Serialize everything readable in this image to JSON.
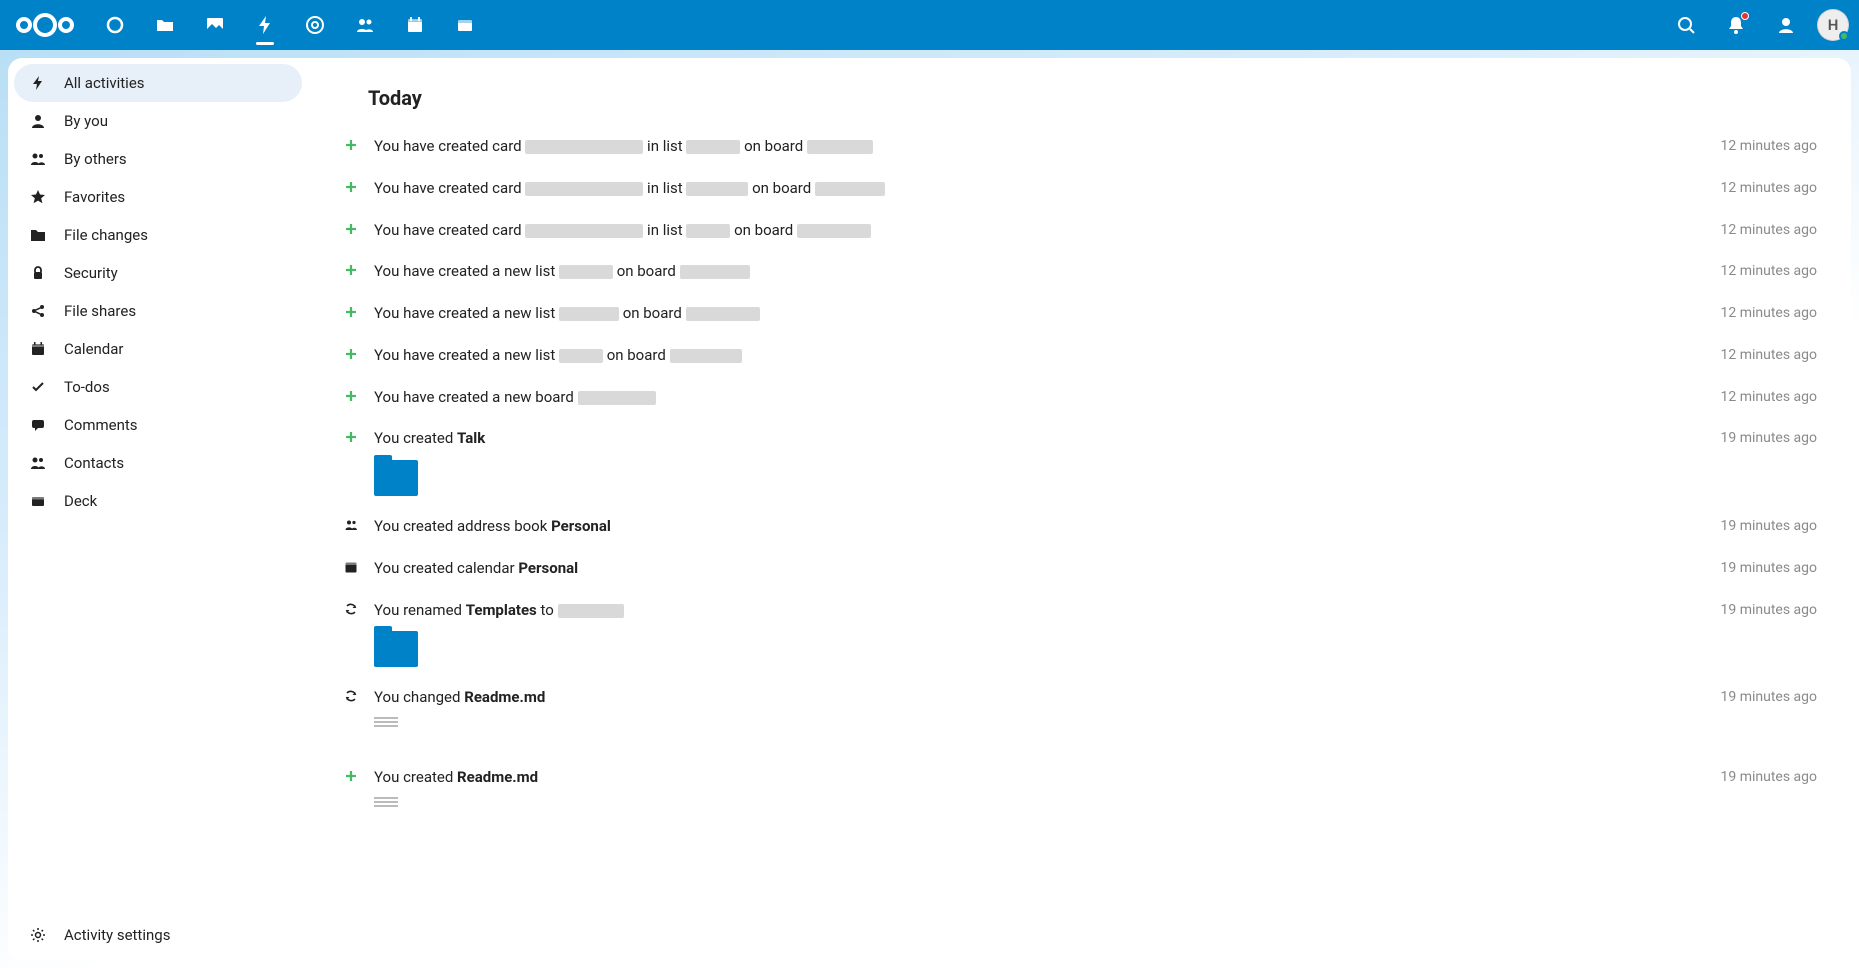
{
  "colors": {
    "brand": "#0082c9",
    "success": "#46ba61",
    "redact": "#d9d9d9"
  },
  "header": {
    "avatar_initial": "H"
  },
  "sidebar": {
    "items": [
      {
        "id": "all",
        "label": "All activities",
        "active": true
      },
      {
        "id": "by-you",
        "label": "By you"
      },
      {
        "id": "by-others",
        "label": "By others"
      },
      {
        "id": "favorites",
        "label": "Favorites"
      },
      {
        "id": "file-changes",
        "label": "File changes"
      },
      {
        "id": "security",
        "label": "Security"
      },
      {
        "id": "file-shares",
        "label": "File shares"
      },
      {
        "id": "calendar",
        "label": "Calendar"
      },
      {
        "id": "todos",
        "label": "To-dos"
      },
      {
        "id": "comments",
        "label": "Comments"
      },
      {
        "id": "contacts",
        "label": "Contacts"
      },
      {
        "id": "deck",
        "label": "Deck"
      }
    ],
    "footer": {
      "label": "Activity settings"
    }
  },
  "main": {
    "heading": "Today",
    "activities": [
      {
        "icon": "plus",
        "segments": [
          {
            "t": "You have created card "
          },
          {
            "r": 118
          },
          {
            "t": " in list "
          },
          {
            "r": 54
          },
          {
            "t": " on board "
          },
          {
            "r": 66
          }
        ],
        "time": "12 minutes ago"
      },
      {
        "icon": "plus",
        "segments": [
          {
            "t": "You have created card "
          },
          {
            "r": 118
          },
          {
            "t": " in list "
          },
          {
            "r": 62
          },
          {
            "t": " on board "
          },
          {
            "r": 70
          }
        ],
        "time": "12 minutes ago"
      },
      {
        "icon": "plus",
        "segments": [
          {
            "t": "You have created card "
          },
          {
            "r": 118
          },
          {
            "t": " in list "
          },
          {
            "r": 44
          },
          {
            "t": " on board "
          },
          {
            "r": 74
          }
        ],
        "time": "12 minutes ago"
      },
      {
        "icon": "plus",
        "segments": [
          {
            "t": "You have created a new list "
          },
          {
            "r": 54
          },
          {
            "t": " on board "
          },
          {
            "r": 70
          }
        ],
        "time": "12 minutes ago"
      },
      {
        "icon": "plus",
        "segments": [
          {
            "t": "You have created a new list "
          },
          {
            "r": 60
          },
          {
            "t": " on board "
          },
          {
            "r": 74
          }
        ],
        "time": "12 minutes ago"
      },
      {
        "icon": "plus",
        "segments": [
          {
            "t": "You have created a new list "
          },
          {
            "r": 44
          },
          {
            "t": " on board "
          },
          {
            "r": 72
          }
        ],
        "time": "12 minutes ago"
      },
      {
        "icon": "plus",
        "segments": [
          {
            "t": "You have created a new board "
          },
          {
            "r": 78
          }
        ],
        "time": "12 minutes ago"
      },
      {
        "icon": "plus",
        "segments": [
          {
            "t": "You created "
          },
          {
            "b": "Talk"
          }
        ],
        "time": "19 minutes ago",
        "thumb": "folder"
      },
      {
        "icon": "addressbook",
        "segments": [
          {
            "t": "You created address book "
          },
          {
            "b": "Personal"
          }
        ],
        "time": "19 minutes ago"
      },
      {
        "icon": "calendar",
        "segments": [
          {
            "t": "You created calendar "
          },
          {
            "b": "Personal"
          }
        ],
        "time": "19 minutes ago"
      },
      {
        "icon": "refresh",
        "segments": [
          {
            "t": "You renamed "
          },
          {
            "b": "Templates"
          },
          {
            "t": " to "
          },
          {
            "r": 66
          }
        ],
        "time": "19 minutes ago",
        "thumb": "folder"
      },
      {
        "icon": "refresh",
        "segments": [
          {
            "t": "You changed "
          },
          {
            "b": "Readme.md"
          }
        ],
        "time": "19 minutes ago",
        "thumb": "file"
      },
      {
        "icon": "plus",
        "segments": [
          {
            "t": "You created "
          },
          {
            "b": "Readme.md"
          }
        ],
        "time": "19 minutes ago",
        "thumb": "file"
      }
    ]
  }
}
